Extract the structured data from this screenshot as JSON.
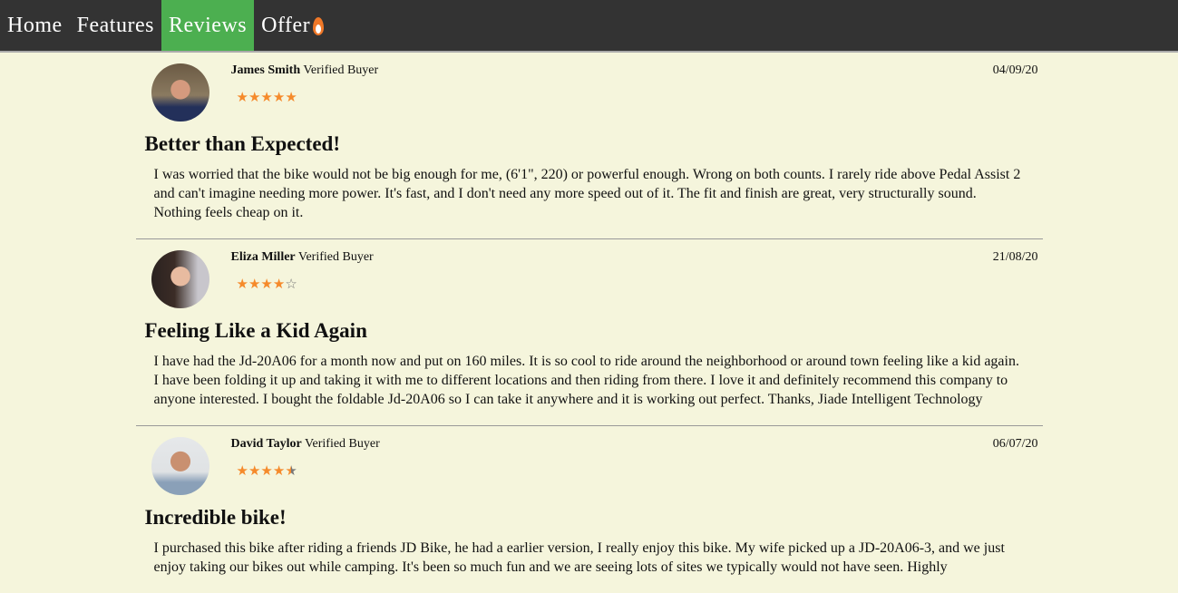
{
  "nav": {
    "items": [
      {
        "label": "Home"
      },
      {
        "label": "Features"
      },
      {
        "label": "Reviews",
        "active": true
      },
      {
        "label": "Offer",
        "icon": "flame-icon"
      }
    ]
  },
  "colors": {
    "nav_bg": "#333333",
    "active": "#4caf50",
    "star": "#f58a2b",
    "page_bg": "#f5f5dc"
  },
  "reviews": [
    {
      "name": "James Smith",
      "badge": "Verified Buyer",
      "date": "04/09/20",
      "rating": 5,
      "title": "Better than Expected!",
      "body": "I was worried that the bike would not be big enough for me, (6'1\", 220) or powerful enough. Wrong on both counts. I rarely ride above Pedal Assist 2 and can't imagine needing more power. It's fast, and I don't need any more speed out of it. The fit and finish are great, very structurally sound. Nothing feels cheap on it."
    },
    {
      "name": "Eliza Miller",
      "badge": "Verified Buyer",
      "date": "21/08/20",
      "rating": 4,
      "title": "Feeling Like a Kid Again",
      "body": "I have had the Jd-20A06 for a month now and put on 160 miles. It is so cool to ride around the neighborhood or around town feeling like a kid again. I have been folding it up and taking it with me to different locations and then riding from there. I love it and definitely recommend this company to anyone interested. I bought the foldable Jd-20A06 so I can take it anywhere and it is working out perfect. Thanks, Jiade Intelligent Technology"
    },
    {
      "name": "David Taylor",
      "badge": "Verified Buyer",
      "date": "06/07/20",
      "rating": 4.5,
      "title": "Incredible bike!",
      "body": "I purchased this bike after riding a friends JD Bike, he had a earlier version, I really enjoy this bike. My wife picked up a JD-20A06-3, and we just enjoy taking our bikes out while camping. It's been so much fun and we are seeing lots of sites we typically would not have seen. Highly"
    }
  ]
}
